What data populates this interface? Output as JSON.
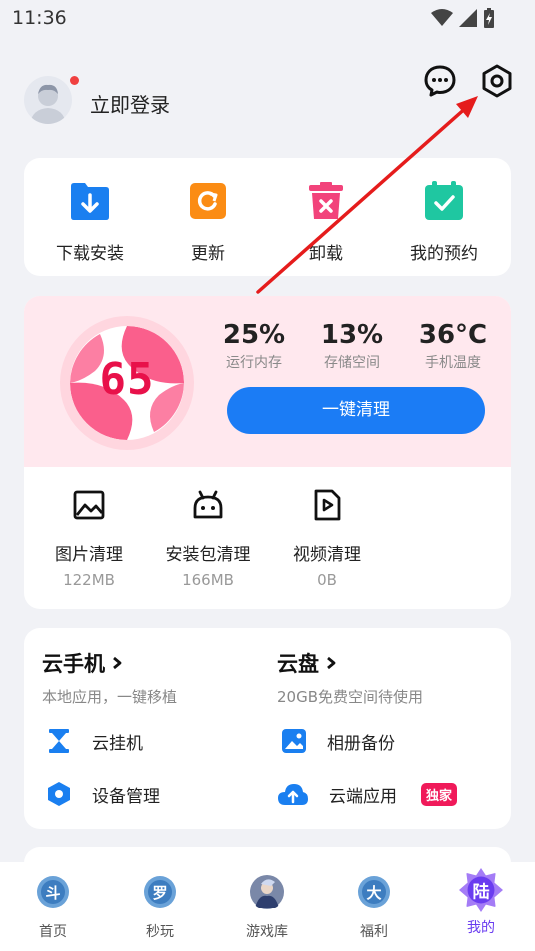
{
  "status_bar": {
    "time": "11:36"
  },
  "header": {
    "login_label": "立即登录"
  },
  "quick_actions": [
    {
      "label": "下载安装",
      "icon": "download-icon"
    },
    {
      "label": "更新",
      "icon": "update-icon"
    },
    {
      "label": "卸载",
      "icon": "trash-icon"
    },
    {
      "label": "我的预约",
      "icon": "calendar-check-icon"
    }
  ],
  "cleaner": {
    "score": "65",
    "stats": [
      {
        "value": "25%",
        "label": "运行内存"
      },
      {
        "value": "13%",
        "label": "存储空间"
      },
      {
        "value": "36°C",
        "label": "手机温度"
      }
    ],
    "clean_button": "一键清理",
    "tools": [
      {
        "name": "图片清理",
        "size": "122MB",
        "icon": "image-icon"
      },
      {
        "name": "安装包清理",
        "size": "166MB",
        "icon": "android-icon"
      },
      {
        "name": "视频清理",
        "size": "0B",
        "icon": "video-icon"
      }
    ]
  },
  "cloud": {
    "phone": {
      "title": "云手机",
      "subtitle": "本地应用，一键移植",
      "items": [
        "云挂机",
        "设备管理"
      ]
    },
    "disk": {
      "title": "云盘",
      "subtitle": "20GB免费空间待使用",
      "items": [
        "相册备份",
        "云端应用"
      ],
      "badge": "独家"
    }
  },
  "tabs": [
    {
      "label": "首页",
      "glyph": "斗"
    },
    {
      "label": "秒玩",
      "glyph": "罗"
    },
    {
      "label": "游戏库",
      "glyph": ""
    },
    {
      "label": "福利",
      "glyph": "大"
    },
    {
      "label": "我的",
      "glyph": "陆"
    }
  ],
  "colors": {
    "accent_blue": "#1b7cf5",
    "score_red": "#e8114a",
    "active_tab": "#6a3cf0",
    "annotation_arrow": "#e51c1c"
  }
}
